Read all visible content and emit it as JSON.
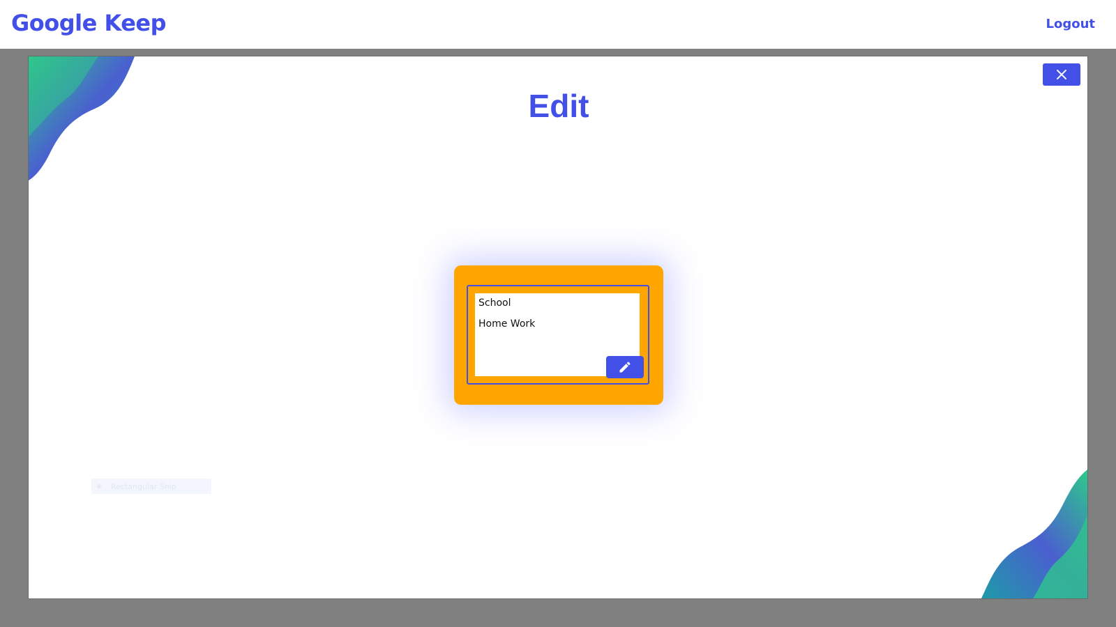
{
  "navbar": {
    "brand": "Google Keep",
    "logout_label": "Logout"
  },
  "modal": {
    "title": "Edit",
    "close_icon": "close-icon",
    "note": {
      "title": "School",
      "body": "Home Work",
      "edit_icon": "pencil-icon"
    },
    "ghost_overlay_label": "Rectangular Snip"
  },
  "colors": {
    "accent": "#4250e8",
    "note_background": "#ffa500",
    "overlay": "#808080"
  }
}
